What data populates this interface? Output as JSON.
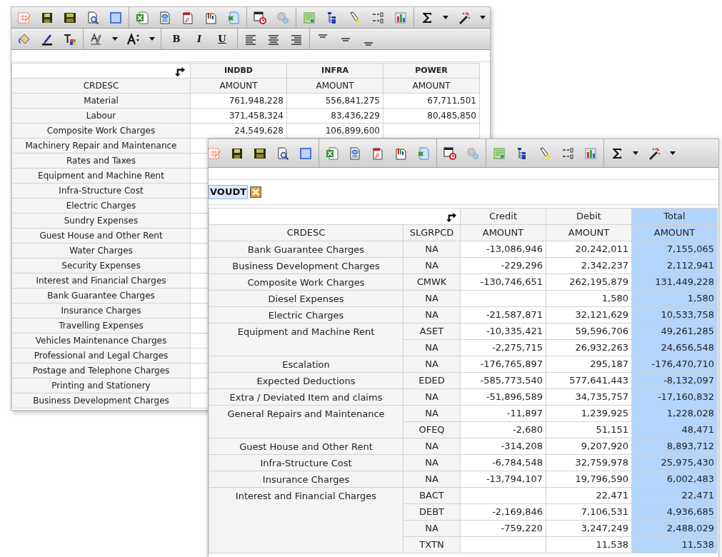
{
  "back_window": {
    "format_buttons": [
      {
        "label": "B",
        "kind": "bold"
      },
      {
        "label": "I",
        "kind": "italic"
      },
      {
        "label": "U",
        "kind": "underline"
      }
    ],
    "table": {
      "row_header": "CRDESC",
      "columns": [
        {
          "label": "INDBD",
          "measure": "AMOUNT"
        },
        {
          "label": "INFRA",
          "measure": "AMOUNT"
        },
        {
          "label": "POWER",
          "measure": "AMOUNT"
        }
      ],
      "rows": [
        {
          "label": "Material",
          "values": [
            "761,948,228",
            "556,841,275",
            "67,711,501"
          ]
        },
        {
          "label": "Labour",
          "values": [
            "371,458,324",
            "83,436,229",
            "80,485,850"
          ]
        },
        {
          "label": "Composite Work Charges",
          "values": [
            "24,549,628",
            "106,899,600"
          ]
        },
        {
          "label": "Machinery Repair and Maintenance"
        },
        {
          "label": "Rates and Taxes"
        },
        {
          "label": "Equipment and Machine Rent"
        },
        {
          "label": "Infra-Structure Cost"
        },
        {
          "label": "Electric Charges"
        },
        {
          "label": "Sundry Expenses"
        },
        {
          "label": "Guest House and Other Rent"
        },
        {
          "label": "Water Charges"
        },
        {
          "label": "Security Expenses"
        },
        {
          "label": "Interest and Financial Charges"
        },
        {
          "label": "Bank Guarantee Charges"
        },
        {
          "label": "Insurance Charges"
        },
        {
          "label": "Travelling Expenses"
        },
        {
          "label": "Vehicles Maintenance Charges"
        },
        {
          "label": "Professional and Legal Charges"
        },
        {
          "label": "Postage and Telephone Charges"
        },
        {
          "label": "Printing and Stationery"
        },
        {
          "label": "Business Development Charges"
        }
      ]
    }
  },
  "front_window": {
    "filter_chip": "VOUDT",
    "table": {
      "row_headers": [
        "CRDESC",
        "SLGRPCD"
      ],
      "columns": [
        {
          "label": "Credit",
          "measure": "AMOUNT",
          "selected": false
        },
        {
          "label": "Debit",
          "measure": "AMOUNT",
          "selected": false
        },
        {
          "label": "Total",
          "measure": "AMOUNT",
          "selected": true
        }
      ],
      "groups": [
        {
          "crdesc": "Bank Guarantee Charges",
          "lines": [
            {
              "slgrpcd": "NA",
              "credit": "-13,086,946",
              "debit": "20,242,011",
              "total": "7,155,065"
            }
          ]
        },
        {
          "crdesc": "Business Development Charges",
          "lines": [
            {
              "slgrpcd": "NA",
              "credit": "-229,296",
              "debit": "2,342,237",
              "total": "2,112,941"
            }
          ]
        },
        {
          "crdesc": "Composite Work Charges",
          "lines": [
            {
              "slgrpcd": "CMWK",
              "credit": "-130,746,651",
              "debit": "262,195,879",
              "total": "131,449,228"
            }
          ]
        },
        {
          "crdesc": "Diesel Expenses",
          "lines": [
            {
              "slgrpcd": "NA",
              "debit": "1,580",
              "total": "1,580"
            }
          ]
        },
        {
          "crdesc": "Electric Charges",
          "lines": [
            {
              "slgrpcd": "NA",
              "credit": "-21,587,871",
              "debit": "32,121,629",
              "total": "10,533,758"
            }
          ]
        },
        {
          "crdesc": "Equipment and Machine Rent",
          "lines": [
            {
              "slgrpcd": "ASET",
              "credit": "-10,335,421",
              "debit": "59,596,706",
              "total": "49,261,285"
            },
            {
              "slgrpcd": "NA",
              "credit": "-2,275,715",
              "debit": "26,932,263",
              "total": "24,656,548"
            }
          ]
        },
        {
          "crdesc": "Escalation",
          "lines": [
            {
              "slgrpcd": "NA",
              "credit": "-176,765,897",
              "debit": "295,187",
              "total": "-176,470,710"
            }
          ]
        },
        {
          "crdesc": "Expected Deductions",
          "lines": [
            {
              "slgrpcd": "EDED",
              "credit": "-585,773,540",
              "debit": "577,641,443",
              "total": "-8,132,097"
            }
          ]
        },
        {
          "crdesc": "Extra / Deviated Item and claims",
          "lines": [
            {
              "slgrpcd": "NA",
              "credit": "-51,896,589",
              "debit": "34,735,757",
              "total": "-17,160,832"
            }
          ]
        },
        {
          "crdesc": "General Repairs and Maintenance",
          "lines": [
            {
              "slgrpcd": "NA",
              "credit": "-11,897",
              "debit": "1,239,925",
              "total": "1,228,028"
            },
            {
              "slgrpcd": "OFEQ",
              "credit": "-2,680",
              "debit": "51,151",
              "total": "48,471"
            }
          ]
        },
        {
          "crdesc": "Guest House and Other Rent",
          "lines": [
            {
              "slgrpcd": "NA",
              "credit": "-314,208",
              "debit": "9,207,920",
              "total": "8,893,712"
            }
          ]
        },
        {
          "crdesc": "Infra-Structure Cost",
          "lines": [
            {
              "slgrpcd": "NA",
              "credit": "-6,784,548",
              "debit": "32,759,978",
              "total": "25,975,430"
            }
          ]
        },
        {
          "crdesc": "Insurance Charges",
          "lines": [
            {
              "slgrpcd": "NA",
              "credit": "-13,794,107",
              "debit": "19,796,590",
              "total": "6,002,483"
            }
          ]
        },
        {
          "crdesc": "Interest and Financial Charges",
          "lines": [
            {
              "slgrpcd": "BACT",
              "debit": "22,471",
              "total": "22,471"
            },
            {
              "slgrpcd": "DEBT",
              "credit": "-2,169,846",
              "debit": "7,106,531",
              "total": "4,936,685"
            },
            {
              "slgrpcd": "NA",
              "credit": "-759,220",
              "debit": "3,247,249",
              "total": "2,488,029"
            },
            {
              "slgrpcd": "TXTN",
              "debit": "11,538",
              "total": "11,538"
            }
          ]
        }
      ]
    }
  }
}
